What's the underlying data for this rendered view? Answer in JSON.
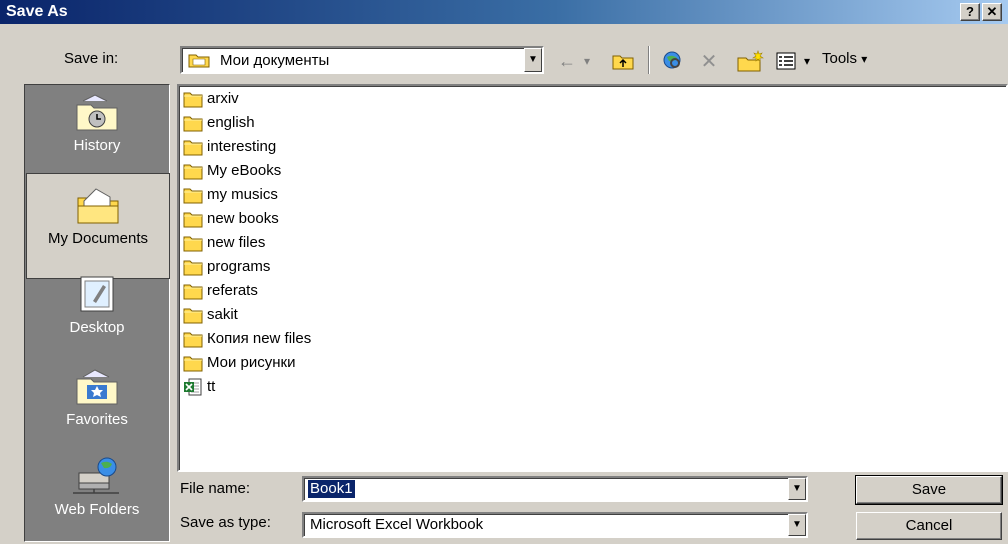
{
  "window": {
    "title": "Save As",
    "help_label": "?",
    "close_label": "✕"
  },
  "toolbar": {
    "save_in_label": "Save in:",
    "location": "Мои документы",
    "tools_label": "Tools",
    "tools_arrow": "▾",
    "views_arrow": "▾"
  },
  "places": [
    {
      "label": "History",
      "icon": "history-icon"
    },
    {
      "label": "My Documents",
      "icon": "my-documents-icon",
      "selected": true
    },
    {
      "label": "Desktop",
      "icon": "desktop-icon"
    },
    {
      "label": "Favorites",
      "icon": "favorites-icon"
    },
    {
      "label": "Web Folders",
      "icon": "web-folders-icon"
    }
  ],
  "files": [
    {
      "name": "arxiv",
      "type": "folder"
    },
    {
      "name": "english",
      "type": "folder"
    },
    {
      "name": "interesting",
      "type": "folder"
    },
    {
      "name": "My eBooks",
      "type": "folder"
    },
    {
      "name": "my musics",
      "type": "folder"
    },
    {
      "name": "new books",
      "type": "folder"
    },
    {
      "name": "new files",
      "type": "folder"
    },
    {
      "name": "programs",
      "type": "folder"
    },
    {
      "name": "referats",
      "type": "folder"
    },
    {
      "name": "sakit",
      "type": "folder"
    },
    {
      "name": "Копия new files",
      "type": "folder"
    },
    {
      "name": "Мои рисунки",
      "type": "folder"
    },
    {
      "name": "tt",
      "type": "excel"
    }
  ],
  "form": {
    "file_name_label": "File name:",
    "file_name_value": "Book1",
    "save_as_type_label": "Save as type:",
    "save_as_type_value": "Microsoft Excel Workbook"
  },
  "buttons": {
    "save_label": "Save",
    "cancel_label": "Cancel"
  },
  "colors": {
    "folder": "#ffd84d",
    "title_start": "#0a246a",
    "title_end": "#a6caf0",
    "face": "#d4d0c8"
  }
}
